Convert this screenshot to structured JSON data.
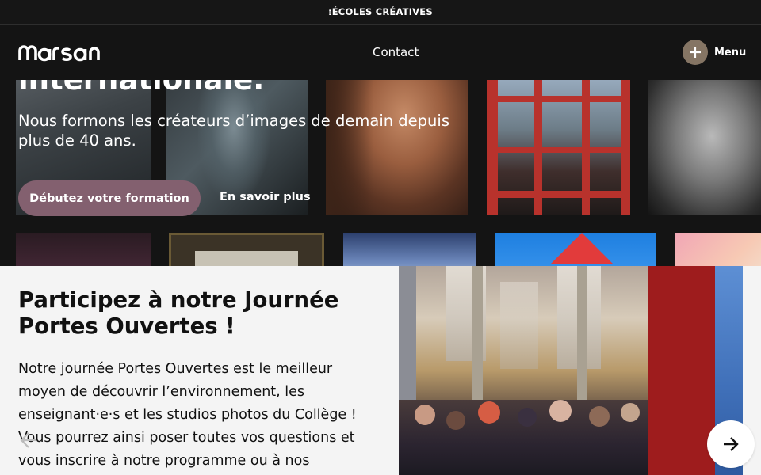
{
  "topbar": {
    "brand": "ÉCOLES CRÉATIVES",
    "brand_prefix": "⁞"
  },
  "header": {
    "logo_text": "marsan",
    "nav": {
      "contact": "Contact"
    },
    "menu_label": "Menu",
    "menu_icon": "plus-icon"
  },
  "hero": {
    "title": "internationale.",
    "subtitle": "Nous formons les créateurs d’images de demain depuis plus de 40 ans.",
    "cta_primary": "Débutez votre formation",
    "cta_secondary": "En savoir plus"
  },
  "open_day": {
    "title": "Participez à notre Journée Portes Ouvertes !",
    "text": "Notre journée Portes Ouvertes est le meilleur moyen de découvrir l’environnement, les enseignant·e·s et les studios photos du Collège ! Vous pourrez ainsi poser toutes vos questions et vous inscrire à notre programme ou à nos ateliers !",
    "prev_icon": "arrow-left-icon",
    "next_icon": "arrow-right-icon"
  },
  "colors": {
    "page_bg": "#141414",
    "section_bg": "#f4f4f4",
    "cta_primary": "#83606f",
    "menu_circle": "#857564",
    "accent_red": "#9e1c1d"
  }
}
